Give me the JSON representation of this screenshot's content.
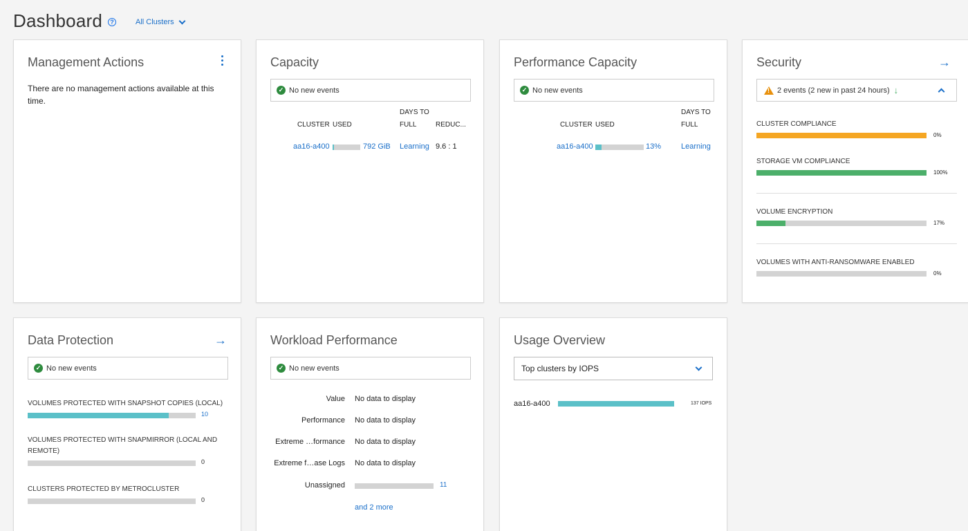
{
  "header": {
    "title": "Dashboard",
    "help_icon": "?",
    "cluster_filter": "All Clusters"
  },
  "colors": {
    "accent": "#1a6fc9",
    "ok": "#2e8b3e",
    "warning_bar": "#f5a623",
    "success_bar": "#4caf6a",
    "teal_bar": "#5bc0c8",
    "bar_bg": "#d3d3d3"
  },
  "management": {
    "title": "Management Actions",
    "message": "There are no management actions available at this time."
  },
  "capacity": {
    "title": "Capacity",
    "events": "No new events",
    "headers": {
      "cluster": "CLUSTER",
      "used": "USED",
      "days_line1": "DAYS TO",
      "days_line2": "FULL",
      "reduction": "REDUC..."
    },
    "row": {
      "cluster": "aa16-a400",
      "used": "792 GiB",
      "used_fraction": 0.05,
      "days": "Learning",
      "reduction": "9.6 : 1"
    }
  },
  "perf_capacity": {
    "title": "Performance Capacity",
    "events": "No new events",
    "headers": {
      "cluster": "CLUSTER",
      "used": "USED",
      "days_line1": "DAYS TO",
      "days_line2": "FULL"
    },
    "row": {
      "cluster": "aa16-a400",
      "used": "13%",
      "used_fraction": 0.13,
      "days": "Learning"
    }
  },
  "security": {
    "title": "Security",
    "events": "2 events (2 new in past 24 hours)",
    "items": [
      {
        "label": "CLUSTER COMPLIANCE",
        "value": "0%",
        "fraction": 1.0,
        "color": "#f5a623"
      },
      {
        "label": "STORAGE VM COMPLIANCE",
        "value": "100%",
        "fraction": 1.0,
        "color": "#4caf6a"
      },
      {
        "label": "VOLUME ENCRYPTION",
        "value": "17%",
        "fraction": 0.17,
        "color": "#4caf6a"
      },
      {
        "label": "VOLUMES WITH ANTI-RANSOMWARE ENABLED",
        "value": "0%",
        "fraction": 0.0,
        "color": "#4caf6a"
      }
    ]
  },
  "data_protection": {
    "title": "Data Protection",
    "events": "No new events",
    "items": [
      {
        "label": "VOLUMES PROTECTED WITH SNAPSHOT COPIES (LOCAL)",
        "value": "10",
        "fraction": 0.84
      },
      {
        "label": "VOLUMES PROTECTED WITH SNAPMIRROR (LOCAL AND REMOTE)",
        "value": "0",
        "fraction": 0.0
      },
      {
        "label": "CLUSTERS PROTECTED BY METROCLUSTER",
        "value": "0",
        "fraction": 0.0
      }
    ]
  },
  "workload": {
    "title": "Workload Performance",
    "events": "No new events",
    "rows": [
      {
        "label": "Value",
        "value": "No data to display"
      },
      {
        "label": "Performance",
        "value": "No data to display"
      },
      {
        "label": "Extreme …formance",
        "value": "No data to display"
      },
      {
        "label": "Extreme f…ase Logs",
        "value": "No data to display"
      }
    ],
    "unassigned": {
      "label": "Unassigned",
      "value": "11",
      "fraction": 0.0
    },
    "more": "and 2 more"
  },
  "usage": {
    "title": "Usage Overview",
    "selected": "Top clusters by IOPS",
    "row": {
      "cluster": "aa16-a400",
      "value": "137 IOPS",
      "fraction": 1.0
    }
  }
}
